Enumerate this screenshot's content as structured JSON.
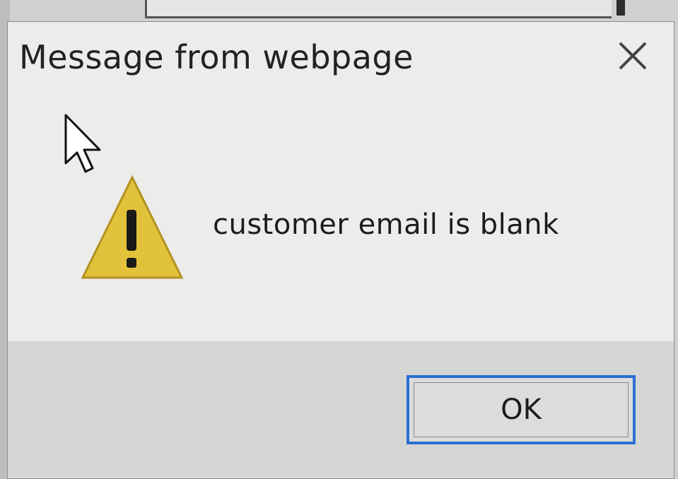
{
  "dialog": {
    "title": "Message from webpage",
    "message": "customer email is blank",
    "ok_label": "OK",
    "icon": "warning-icon",
    "close_icon": "close-icon"
  },
  "colors": {
    "dialog_bg": "#ececea",
    "footer_bg": "#d6d6d4",
    "focus_border": "#2a6fd6",
    "warning_fill": "#e2c23a",
    "text": "#222222"
  }
}
